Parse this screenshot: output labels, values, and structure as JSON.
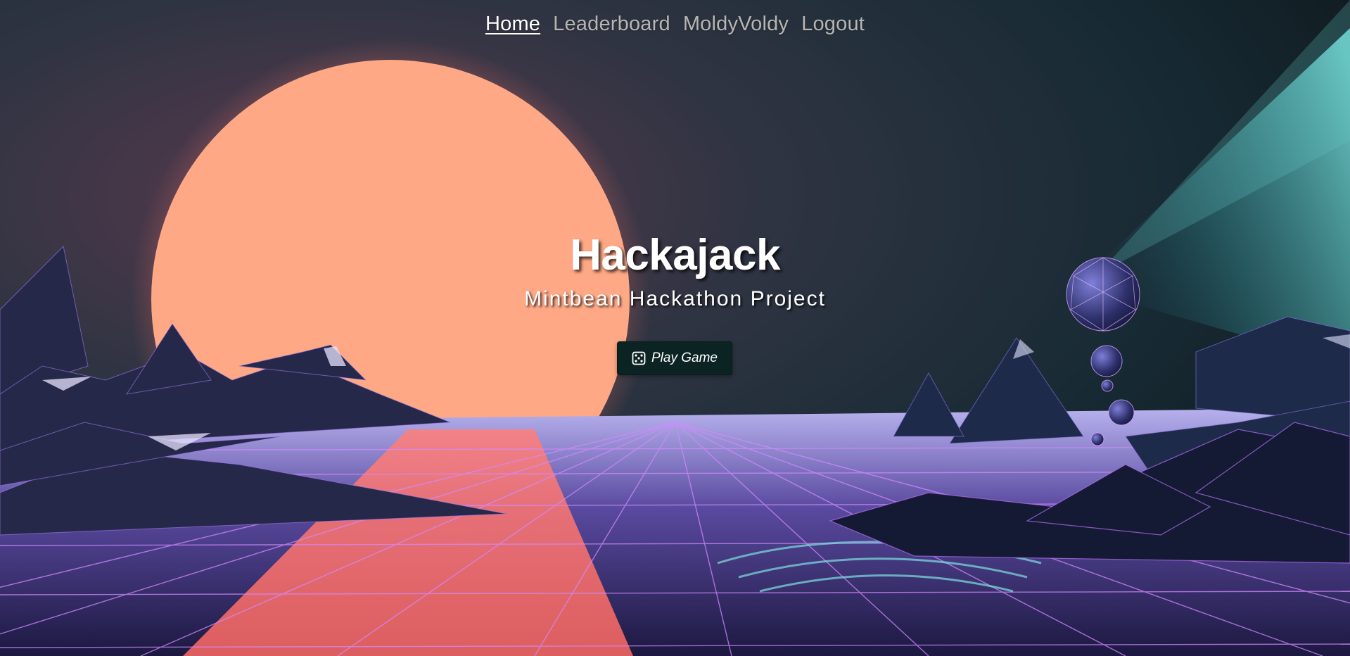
{
  "nav": {
    "items": [
      {
        "label": "Home",
        "active": true
      },
      {
        "label": "Leaderboard",
        "active": false
      },
      {
        "label": "MoldyVoldy",
        "active": false
      },
      {
        "label": "Logout",
        "active": false
      }
    ]
  },
  "hero": {
    "title": "Hackajack",
    "subtitle": "Mintbean Hackathon Project",
    "play_button": {
      "label": "Play Game",
      "icon": "dice-icon"
    }
  },
  "background": {
    "description_icon": "synthwave-landscape",
    "colors": {
      "sun": "#ffa985",
      "sky_dark": "#1d2a33",
      "beam_teal": "#5fc6c4",
      "grid_purple": "#c37bff",
      "mountain_shadow": "#1b2140",
      "button_bg": "#0c2323"
    }
  }
}
